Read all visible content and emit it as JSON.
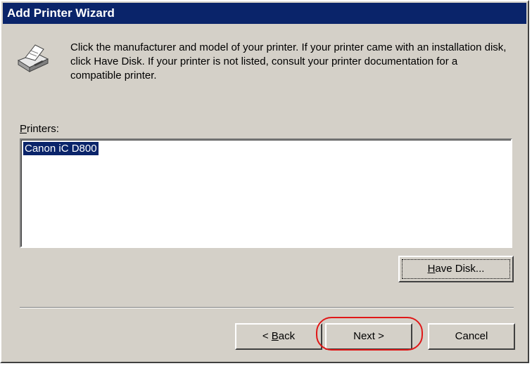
{
  "window": {
    "title": "Add Printer Wizard"
  },
  "header": {
    "icon": "printer-icon",
    "instructions": "Click the manufacturer and model of your printer. If your printer came with an installation disk, click Have Disk. If your printer is not listed, consult your printer documentation for a compatible printer."
  },
  "printers": {
    "label_accel": "P",
    "label_rest": "rinters:",
    "items": [
      "Canon iC D800"
    ],
    "selected": "Canon iC D800"
  },
  "buttons": {
    "have_disk_accel": "H",
    "have_disk_rest": "ave Disk...",
    "back_prefix": "< ",
    "back_accel": "B",
    "back_rest": "ack",
    "next": "Next >",
    "cancel": "Cancel"
  },
  "colors": {
    "titlebar": "#0a246a",
    "selection": "#0a246a",
    "dialog_face": "#d4d0c8",
    "annotation": "#e01818"
  }
}
